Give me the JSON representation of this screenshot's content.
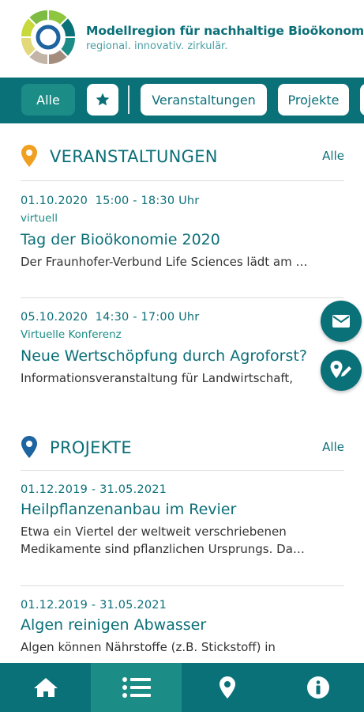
{
  "header": {
    "title": "Modellregion für nachhaltige Bioökonomie",
    "subtitle": "regional. innovativ. zirkulär."
  },
  "filters": {
    "all": "Alle",
    "events": "Veranstaltungen",
    "projects": "Projekte",
    "active": "Alle"
  },
  "sections": {
    "events": {
      "title": "VERANSTALTUNGEN",
      "all_link": "Alle",
      "items": [
        {
          "date": "01.10.2020",
          "time": "15:00 - 18:30 Uhr",
          "location": "virtuell",
          "title": "Tag der Bioökonomie 2020",
          "description": "Der Fraunhofer-Verbund Life Sciences lädt am …"
        },
        {
          "date": "05.10.2020",
          "time": "14:30 - 17:00 Uhr",
          "location": "Virtuelle Konferenz",
          "title": "Neue Wertschöpfung durch Agroforst?",
          "description": "Informationsveranstaltung für Landwirtschaft,"
        }
      ]
    },
    "projects": {
      "title": "PROJEKTE",
      "all_link": "Alle",
      "items": [
        {
          "period": "01.12.2019 - 31.05.2021",
          "title": "Heilpflanzenanbau im Revier",
          "description": "Etwa ein Viertel der weltweit verschriebenen Medikamente sind pflanzlichen Ursprungs. Da…"
        },
        {
          "period": "01.12.2019 - 31.05.2021",
          "title": "Algen reinigen Abwasser",
          "description": "Algen können Nährstoffe (z.B. Stickstoff) in"
        }
      ]
    }
  },
  "colors": {
    "primary": "#0b7179",
    "accent": "#1b8d86",
    "event_pin": "#f0a020",
    "project_pin": "#1e64a0"
  },
  "icons": {
    "star": "star-icon",
    "mail": "mail-icon",
    "edit_location": "edit-location-icon",
    "home": "home-icon",
    "list": "list-icon",
    "map": "map-pin-icon",
    "info": "info-icon"
  },
  "bottom_nav": {
    "active": "list"
  }
}
